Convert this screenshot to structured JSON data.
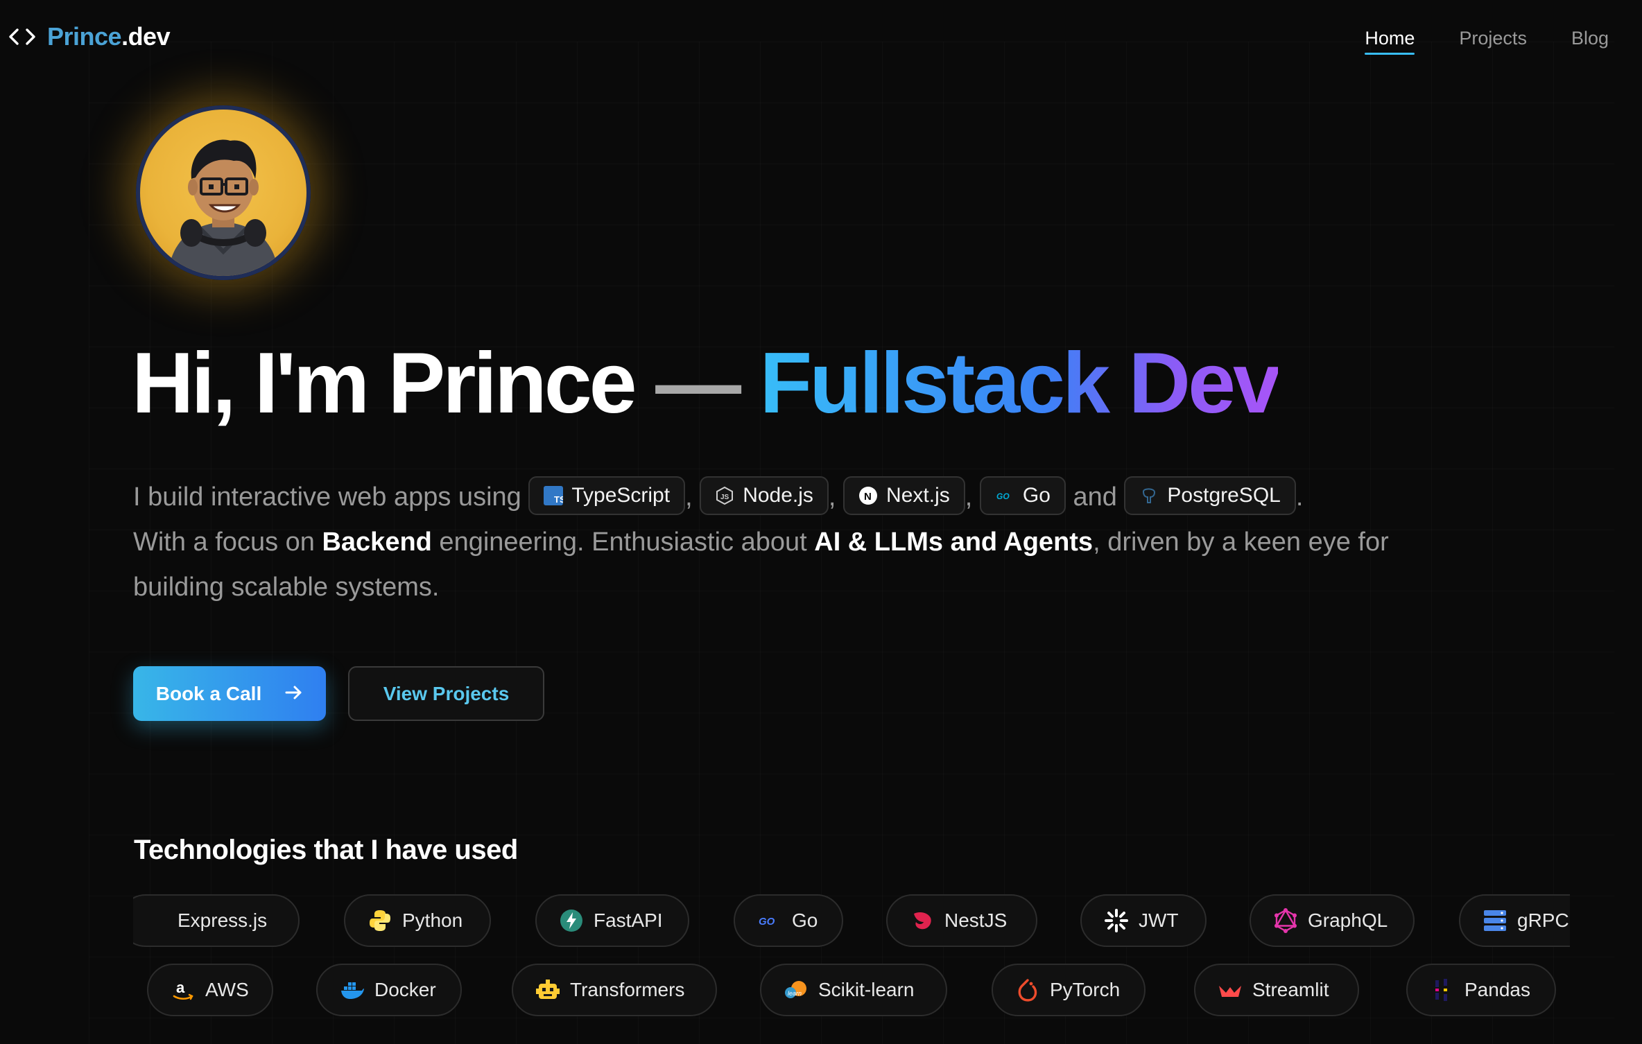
{
  "brand": {
    "name": "Prince",
    "tld": ".dev"
  },
  "nav": {
    "items": [
      "Home",
      "Projects",
      "Blog"
    ],
    "active": "Home"
  },
  "hero": {
    "name_part": "Hi, I'm Prince",
    "dash": " — ",
    "role": "Fullstack Dev"
  },
  "intro": {
    "prefix": "I build interactive web apps using ",
    "chips": [
      "TypeScript",
      "Node.js",
      "Next.js",
      "Go",
      "PostgreSQL"
    ],
    "comma": ",",
    "and": "and",
    "period": ".",
    "line2_a": "With a focus on ",
    "line2_b": "Backend",
    "line2_c": " engineering. Enthusiastic about ",
    "line2_d": "AI & LLMs and Agents",
    "line2_e": ", driven by a keen eye for building scalable systems."
  },
  "buttons": {
    "book_call": "Book a Call",
    "view_projects": "View Projects"
  },
  "technologies": {
    "title": "Technologies that I have used",
    "row1": [
      "Express.js",
      "Python",
      "FastAPI",
      "Go",
      "NestJS",
      "JWT",
      "GraphQL",
      "gRPC"
    ],
    "row2": [
      "AWS",
      "Docker",
      "Transformers",
      "Scikit-learn",
      "PyTorch",
      "Streamlit",
      "Pandas"
    ]
  },
  "colors": {
    "background": "#0a0a0a",
    "accent_blue": "#38bdf8",
    "accent_purple": "#a855f7",
    "brand_blue": "#4ba3d6",
    "avatar_gold": "#eab33a"
  }
}
